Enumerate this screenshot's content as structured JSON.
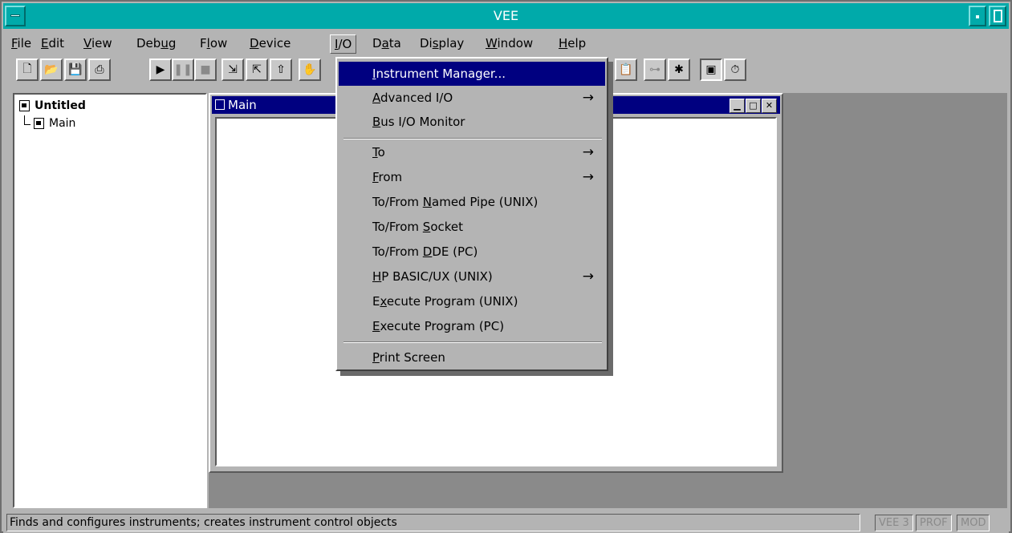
{
  "window": {
    "title": "VEE"
  },
  "menubar": {
    "items": [
      {
        "label": "File"
      },
      {
        "label": "Edit"
      },
      {
        "label": "View"
      },
      {
        "label": "Debug"
      },
      {
        "label": "Flow"
      },
      {
        "label": "Device"
      },
      {
        "label": "I/O"
      },
      {
        "label": "Data"
      },
      {
        "label": "Display"
      },
      {
        "label": "Window"
      },
      {
        "label": "Help"
      }
    ],
    "active": "I/O"
  },
  "toolbar": {
    "icons": [
      "new-icon",
      "open-icon",
      "save-icon",
      "print-icon",
      "run-icon",
      "pause-icon",
      "stop-icon",
      "step-into-icon",
      "step-over-icon",
      "step-out-icon",
      "hand-icon",
      "clipboard-icon",
      "wire-icon",
      "probe-icon",
      "panel-view-icon",
      "timer-icon"
    ]
  },
  "tree": {
    "root": "Untitled",
    "child": "Main"
  },
  "main_window": {
    "title": "Main"
  },
  "io_menu": {
    "items": [
      {
        "label": "Instrument Manager...",
        "arrow": ""
      },
      {
        "label": "Advanced I/O",
        "arrow": "→"
      },
      {
        "label": "Bus I/O Monitor",
        "arrow": ""
      },
      {
        "label": "To",
        "arrow": "→"
      },
      {
        "label": "From",
        "arrow": "→"
      },
      {
        "label": "To/From Named Pipe (UNIX)",
        "arrow": ""
      },
      {
        "label": "To/From Socket",
        "arrow": ""
      },
      {
        "label": "To/From DDE (PC)",
        "arrow": ""
      },
      {
        "label": "HP BASIC/UX (UNIX)",
        "arrow": "→"
      },
      {
        "label": "Execute Program (UNIX)",
        "arrow": ""
      },
      {
        "label": "Execute Program (PC)",
        "arrow": ""
      },
      {
        "label": "Print Screen",
        "arrow": ""
      }
    ],
    "highlighted": "Instrument Manager..."
  },
  "statusbar": {
    "text": "Finds and configures instruments; creates instrument control objects",
    "badges": [
      "VEE 3",
      "PROF",
      "MOD"
    ]
  }
}
